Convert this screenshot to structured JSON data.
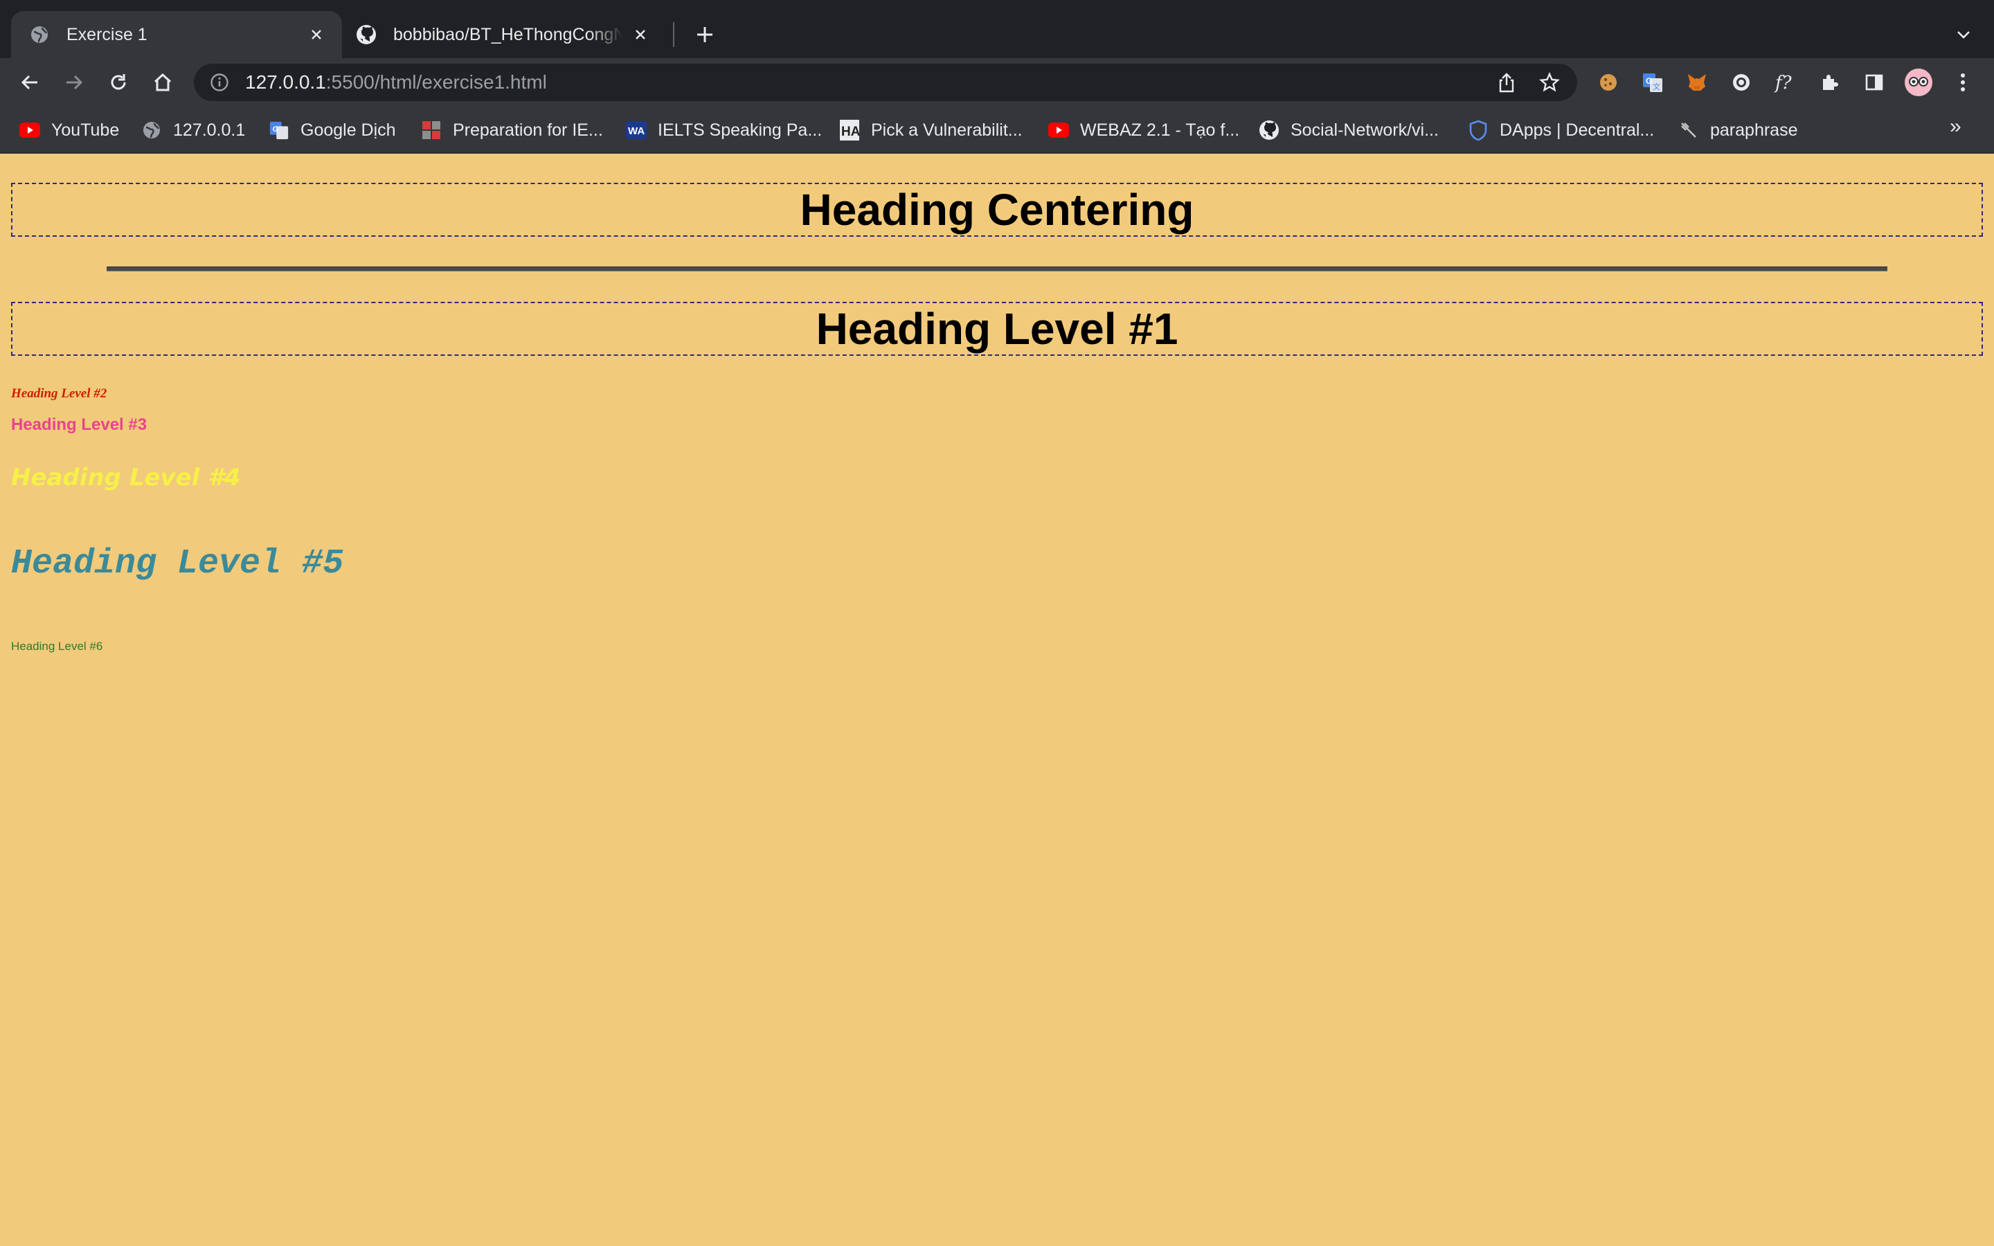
{
  "tabs": [
    {
      "title": "Exercise 1",
      "active": true,
      "favicon": "globe-icon"
    },
    {
      "title": "bobbibao/BT_HeThongCongNghe",
      "active": false,
      "favicon": "github-icon"
    }
  ],
  "omnibox": {
    "host": "127.0.0.1",
    "path": ":5500/html/exercise1.html"
  },
  "bookmarks": [
    {
      "label": "YouTube",
      "icon": "youtube-icon"
    },
    {
      "label": "127.0.0.1",
      "icon": "globe-icon"
    },
    {
      "label": "Google Dịch",
      "icon": "google-translate-icon"
    },
    {
      "label": "Preparation for IE...",
      "icon": "grid-icon"
    },
    {
      "label": "IELTS Speaking Pa...",
      "icon": "ielts-icon"
    },
    {
      "label": "Pick a Vulnerabilit...",
      "icon": "ha-icon"
    },
    {
      "label": "WEBAZ 2.1 - Tạo f...",
      "icon": "youtube-icon"
    },
    {
      "label": "Social-Network/vi...",
      "icon": "github-icon"
    },
    {
      "label": "DApps | Decentral...",
      "icon": "shield-icon"
    },
    {
      "label": "paraphrase",
      "icon": "feather-icon"
    }
  ],
  "bookmarks_overflow": "»",
  "content": {
    "heading_centering": "Heading Centering",
    "h1": "Heading Level #1",
    "h2": "Heading Level #2",
    "h3": "Heading Level #3",
    "h4": "Heading Level #4",
    "h5": "Heading Level #5",
    "h6": "Heading Level #6"
  },
  "colors": {
    "page_background": "#f2ca7b",
    "h2": "#cc1f00",
    "h3": "#e8458c",
    "h4": "#f6f048",
    "h5": "#3a8a9a",
    "h6": "#2f7a2a"
  }
}
